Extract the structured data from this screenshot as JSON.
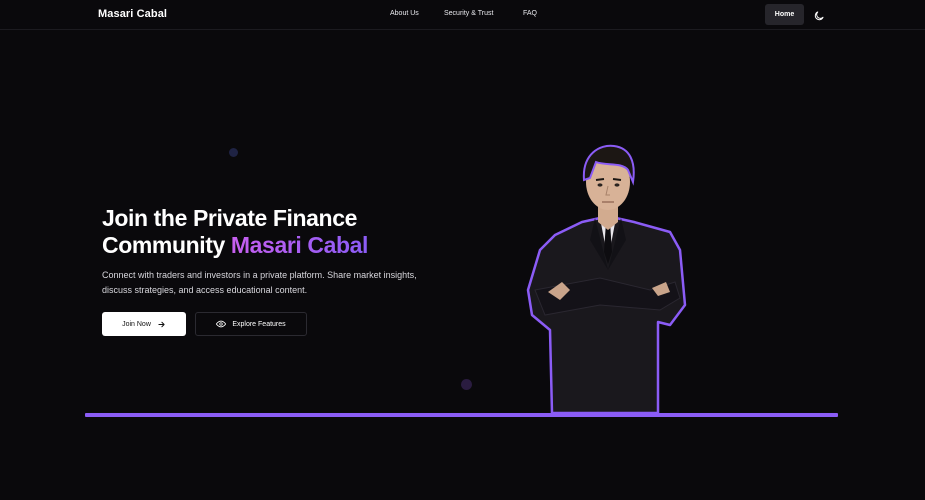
{
  "navbar": {
    "brand": "Masari Cabal",
    "links": [
      {
        "label": "About Us"
      },
      {
        "label": "Security & Trust"
      },
      {
        "label": "FAQ"
      }
    ],
    "home_label": "Home",
    "theme_icon": "moon-icon"
  },
  "hero": {
    "title_line1": "Join the Private Finance",
    "title_line2_prefix": "Community",
    "title_accent": "Masari Cabal",
    "subtitle": "Connect with traders and investors in a private platform. Share market insights, discuss strategies, and access educational content.",
    "join_label": "Join Now",
    "join_icon": "arrow-right-icon",
    "explore_label": "Explore Features",
    "explore_icon": "eye-icon"
  },
  "colors": {
    "background": "#0a090c",
    "accent_purple": "#8b5cf6",
    "accent_pink": "#c75ff0"
  }
}
